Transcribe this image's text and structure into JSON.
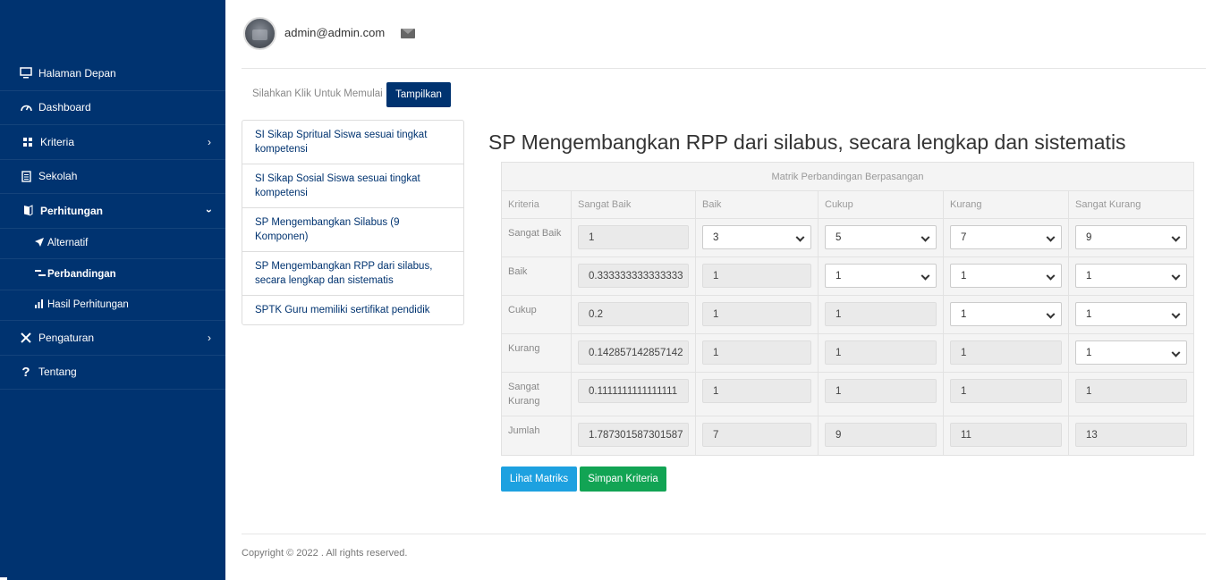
{
  "sidebar": {
    "items": [
      {
        "label": "Halaman Depan",
        "icon": "monitor-icon"
      },
      {
        "label": "Dashboard",
        "icon": "speedometer-icon"
      },
      {
        "label": "Kriteria",
        "icon": "grid-icon"
      },
      {
        "label": "Sekolah",
        "icon": "document-icon"
      },
      {
        "label": "Perhitungan",
        "icon": "book-icon"
      },
      {
        "label": "Pengaturan",
        "icon": "tools-icon"
      },
      {
        "label": "Tentang",
        "icon": "question-icon"
      }
    ],
    "subitems": [
      {
        "label": "Alternatif",
        "icon": "send-icon"
      },
      {
        "label": "Perbandingan",
        "icon": "compare-icon"
      },
      {
        "label": "Hasil Perhitungan",
        "icon": "bar-chart-icon"
      }
    ]
  },
  "header": {
    "email": "admin@admin.com"
  },
  "tabs": {
    "hint": "Silahkan Klik Untuk Memulai",
    "button": "Tampilkan"
  },
  "criteria_list": [
    "SI Sikap Spritual Siswa sesuai tingkat kompetensi",
    "SI Sikap Sosial Siswa sesuai tingkat kompetensi",
    "SP Mengembangkan Silabus (9 Komponen)",
    "SP Mengembangkan RPP dari silabus, secara lengkap dan sistematis",
    "SPTK Guru memiliki sertifikat pendidik"
  ],
  "main": {
    "title": "SP Mengembangkan RPP dari silabus, secara lengkap dan sistematis"
  },
  "matrix": {
    "caption": "Matrik Perbandingan Berpasangan",
    "corner": "Kriteria",
    "columns": [
      "Sangat Baik",
      "Baik",
      "Cukup",
      "Kurang",
      "Sangat Kurang"
    ],
    "rows": [
      {
        "label": "Sangat Baik",
        "values": [
          "1",
          "3",
          "5",
          "7",
          "9"
        ]
      },
      {
        "label": "Baik",
        "values": [
          "0.333333333333333",
          "1",
          "1",
          "1",
          "1"
        ]
      },
      {
        "label": "Cukup",
        "values": [
          "0.2",
          "1",
          "1",
          "1",
          "1"
        ]
      },
      {
        "label": "Kurang",
        "values": [
          "0.142857142857142",
          "1",
          "1",
          "1",
          "1"
        ]
      },
      {
        "label": "Sangat Kurang",
        "values": [
          "0.1111111111111111",
          "1",
          "1",
          "1",
          "1"
        ]
      }
    ],
    "total_label": "Jumlah",
    "totals": [
      "1.787301587301587",
      "7",
      "9",
      "11",
      "13"
    ]
  },
  "buttons": {
    "lihat": "Lihat Matriks",
    "simpan": "Simpan Kriteria"
  },
  "footer": {
    "copyright": "Copyright © 2022 . All rights reserved."
  },
  "colors": {
    "sidebar": "#003370",
    "primary": "#003370",
    "info": "#1da1e0",
    "success": "#12a454"
  }
}
